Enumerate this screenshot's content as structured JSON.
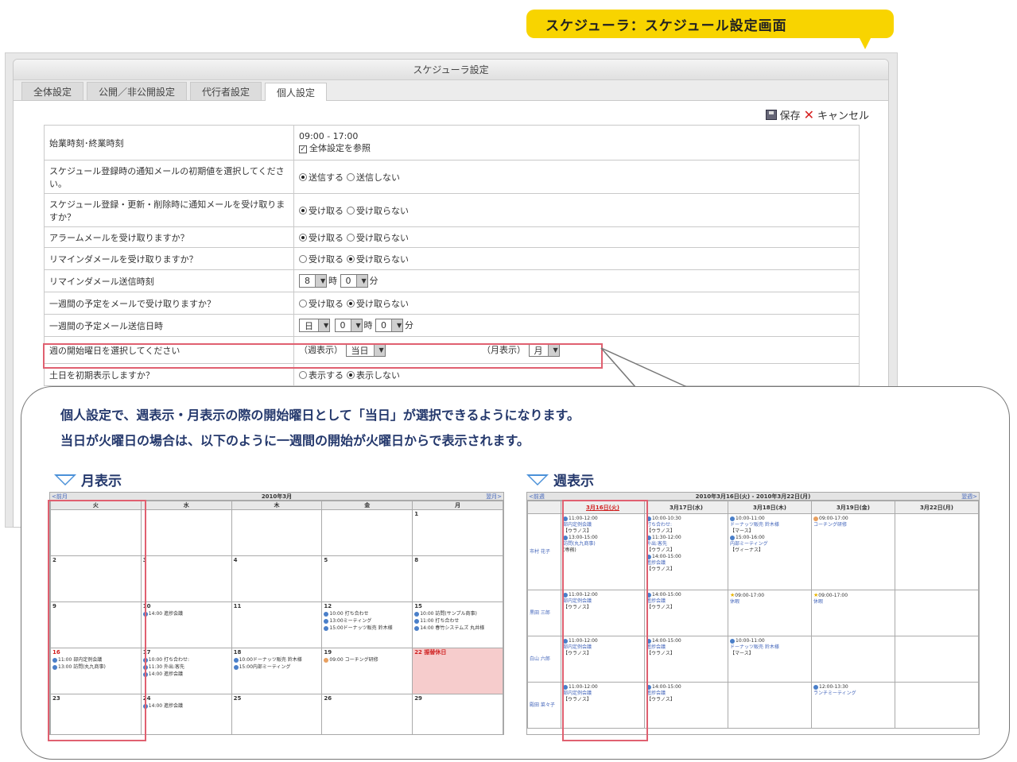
{
  "callout": "スケジューラ：スケジュール設定画面",
  "window_title": "スケジューラ設定",
  "tabs": [
    "全体設定",
    "公開／非公開設定",
    "代行者設定",
    "個人設定"
  ],
  "toolbar": {
    "save": "保存",
    "cancel": "キャンセル"
  },
  "settings": {
    "r0": {
      "q": "始業時刻･終業時刻",
      "v": "09:00 - 17:00",
      "chk": "全体設定を参照"
    },
    "r1": {
      "q": "スケジュール登録時の通知メールの初期値を選択してください。",
      "a": "送信する",
      "b": "送信しない"
    },
    "r2": {
      "q": "スケジュール登録・更新・削除時に通知メールを受け取りますか？",
      "a": "受け取る",
      "b": "受け取らない"
    },
    "r3": {
      "q": "アラームメールを受け取りますか？",
      "a": "受け取る",
      "b": "受け取らない"
    },
    "r4": {
      "q": "リマインダメールを受け取りますか？",
      "a": "受け取る",
      "b": "受け取らない"
    },
    "r5": {
      "q": "リマインダメール送信時刻",
      "h": "8",
      "hu": "時",
      "m": "0",
      "mu": "分"
    },
    "r6": {
      "q": "一週間の予定をメールで受け取りますか？",
      "a": "受け取る",
      "b": "受け取らない"
    },
    "r7": {
      "q": "一週間の予定メール送信日時",
      "d": "日",
      "h": "0",
      "hu": "時",
      "m": "0",
      "mu": "分"
    },
    "r8": {
      "q": "週の開始曜日を選択してください",
      "wl": "（週表示）",
      "wv": "当日",
      "ml": "（月表示）",
      "mv": "月"
    },
    "r9": {
      "q": "土日を初期表示しますか？",
      "a": "表示する",
      "b": "表示しない"
    }
  },
  "bubble": {
    "line1": "個人設定で、週表示・月表示の際の開始曜日として「当日」が選択できるようになります。",
    "line2": "当日が火曜日の場合は、以下のように一週間の開始が火曜日からで表示されます。"
  },
  "month": {
    "title": "月表示",
    "prev": "<前月",
    "next": "翌月>",
    "label": "2010年3月",
    "heads": [
      "火",
      "水",
      "木",
      "金",
      "月"
    ],
    "c": {
      "d1": "1",
      "d2": "2",
      "d3": "3",
      "d4": "4",
      "d5": "5",
      "d8": "8",
      "d9": "9",
      "d10": "10",
      "d11": "11",
      "d12": "12",
      "d15": "15",
      "d16": "16",
      "d17": "17",
      "d18": "18",
      "d19": "19",
      "d22": "22 振替休日",
      "d23": "23",
      "d24": "24",
      "d25": "25",
      "d26": "26",
      "d29": "29"
    },
    "e": {
      "e10a": "14:00 進捗会議",
      "e12a": "10:00 打ち合わせ",
      "e12b": "13:00ミーティング",
      "e12c": "15:00ドーナッツ販売 鈴木様",
      "e15a": "10:00 訪問(サンプル商事)",
      "e15b": "11:00 打ち合わせ",
      "e15c": "14:00 春竹システムズ 丸井様",
      "e16a": "11:00 部内定例会議",
      "e16b": "13:00 訪問(丸九商事)",
      "e17a": "10:00 打ち合わせ:",
      "e17b": "11:30 外出:客先",
      "e17c": "14:00 進捗会議",
      "e18a": "10:00ドーナッツ販売 鈴木様",
      "e18b": "15:00内部ミーティング",
      "e19a": "09:00 コーチング研修",
      "e24a": "14:00 進捗会議"
    }
  },
  "week": {
    "title": "週表示",
    "prev": "<前週",
    "next": "翌週>",
    "label": "2010年3月16日(火) - 2010年3月22日(月)",
    "heads": [
      "3月16日(火)",
      "3月17日(水)",
      "3月18日(木)",
      "3月19日(金)",
      "3月22日(月)"
    ],
    "names": [
      "市村 花子",
      "黒田 三郎",
      "白山 六郎",
      "殿田 菜々子"
    ],
    "e": {
      "a1t": "11:00-12:00",
      "a1n": "部内定例会議",
      "a1p": "【ウラノス】",
      "a2t": "13:00-15:00",
      "a2n": "訪問(丸九商事)",
      "a2p": "(専務)",
      "a3t": "10:00-10:30",
      "a3n": "打ち合わせ:",
      "a3p": "【ウラノス】",
      "a4t": "11:30-12:00",
      "a4n": "外出:客先",
      "a4p": "【ウラノス】",
      "a5t": "14:00-15:00",
      "a5n": "進捗会議",
      "a5p": "【ウラノス】",
      "a6t": "10:00-11:00",
      "a6n": "ドーナッツ販売 鈴木様",
      "a6p": "【マース】",
      "a7t": "15:00-16:00",
      "a7n": "内部ミーティング",
      "a7p": "【ヴィーナス】",
      "a8t": "09:00-17:00",
      "a8n": "コーチング研修",
      "b1t": "11:00-12:00",
      "b1n": "部内定例会議",
      "b1p": "【ウラノス】",
      "b2t": "14:00-15:00",
      "b2n": "進捗会議",
      "b2p": "【ウラノス】",
      "b3t": "09:00-17:00",
      "b3n": "休暇",
      "b4t": "09:00-17:00",
      "b4n": "休暇",
      "c1t": "11:00-12:00",
      "c1n": "部内定例会議",
      "c1p": "【ウラノス】",
      "c2t": "14:00-15:00",
      "c2n": "進捗会議",
      "c2p": "【ウラノス】",
      "c3t": "10:00-11:00",
      "c3n": "ドーナッツ販売 鈴木様",
      "c3p": "【マース】",
      "d1t": "11:00-12:00",
      "d1n": "部内定例会議",
      "d1p": "【ウラノス】",
      "d2t": "14:00-15:00",
      "d2n": "進捗会議",
      "d2p": "【ウラノス】",
      "d3t": "12:00-13:30",
      "d3n": "ランチミーティング"
    }
  }
}
